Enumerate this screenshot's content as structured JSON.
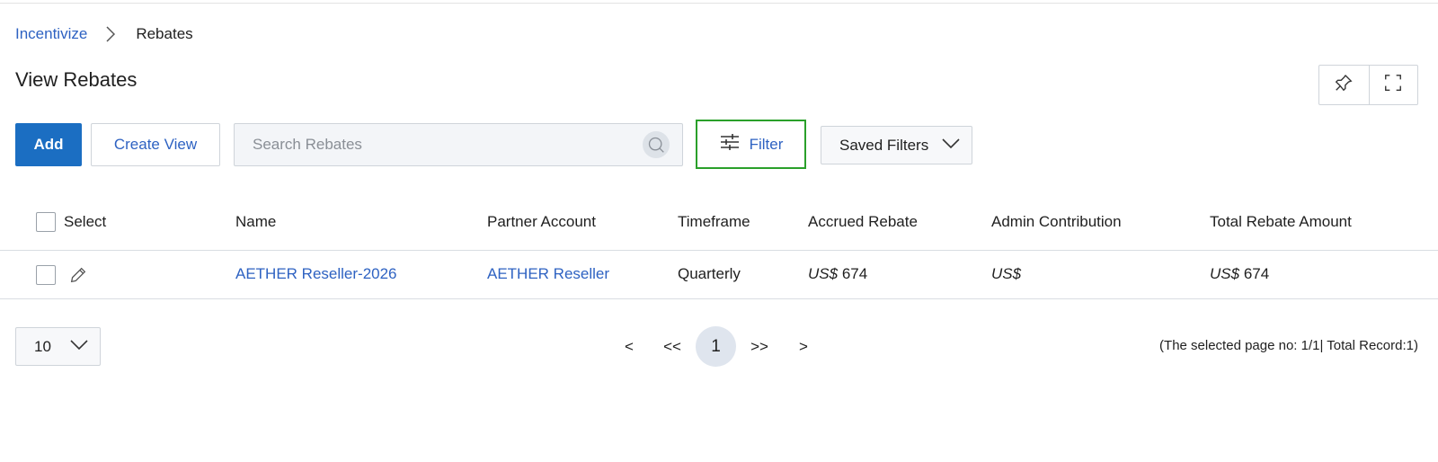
{
  "breadcrumb": {
    "parent": "Incentivize",
    "current": "Rebates"
  },
  "page": {
    "title": "View Rebates"
  },
  "toolbar": {
    "add_label": "Add",
    "create_view_label": "Create View",
    "search_placeholder": "Search Rebates",
    "filter_label": "Filter",
    "saved_filters_label": "Saved Filters"
  },
  "table": {
    "columns": [
      "Select",
      "Name",
      "Partner Account",
      "Timeframe",
      "Accrued Rebate",
      "Admin Contribution",
      "Total Rebate Amount"
    ],
    "rows": [
      {
        "name": "AETHER Reseller-2026",
        "partner_account": "AETHER Reseller",
        "timeframe": "Quarterly",
        "accrued_currency": "US$",
        "accrued_value": "674",
        "admin_currency": "US$",
        "admin_value": "",
        "total_currency": "US$",
        "total_value": "674"
      }
    ]
  },
  "pagination": {
    "page_size": "10",
    "prev": "<",
    "first": "<<",
    "current": "1",
    "last": ">>",
    "next": ">",
    "info": "(The selected page no: 1/1| Total Record:1)"
  },
  "colors": {
    "primary": "#1b6ec2",
    "link": "#2e62c2",
    "filter_border": "#2aa02a"
  }
}
